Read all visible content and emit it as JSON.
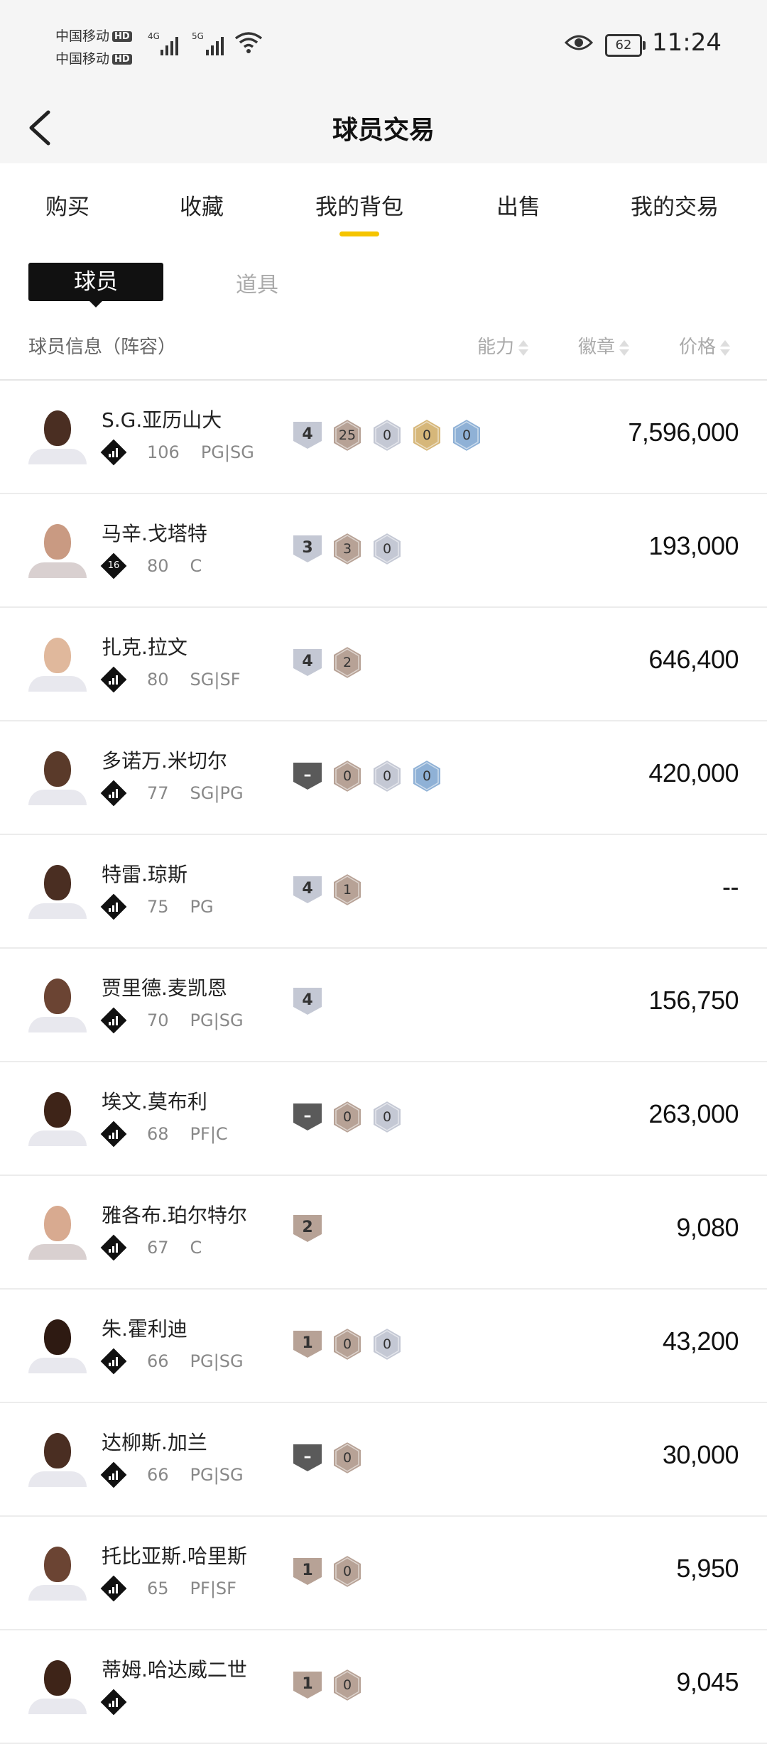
{
  "status_bar": {
    "carrier1": "中国移动",
    "carrier2": "中国移动",
    "hd": "HD",
    "sig1": "4G",
    "sig2": "5G",
    "battery": "62",
    "time": "11:24"
  },
  "header": {
    "title": "球员交易"
  },
  "tabs": [
    {
      "label": "购买"
    },
    {
      "label": "收藏"
    },
    {
      "label": "我的背包",
      "active": true
    },
    {
      "label": "出售"
    },
    {
      "label": "我的交易"
    }
  ],
  "subtabs": {
    "active": "球员",
    "inactive": "道具"
  },
  "columns": {
    "info": "球员信息（阵容）",
    "ability": "能力",
    "badge": "徽章",
    "price": "价格"
  },
  "colors": {
    "accent": "#f5c400",
    "silver": "#c4c8d4",
    "bronze": "#b7a296",
    "gold": "#d6b77a",
    "blue": "#8fb1d6",
    "dark_shield": "#5a5a5a"
  },
  "players": [
    {
      "name": "S.G.亚历山大",
      "rating": "106",
      "pos": "PG|SG",
      "tier_icon": "bars",
      "shield": {
        "label": "4",
        "color": "silver"
      },
      "badges": [
        {
          "label": "25",
          "color": "bronze"
        },
        {
          "label": "0",
          "color": "silver"
        },
        {
          "label": "0",
          "color": "gold"
        },
        {
          "label": "0",
          "color": "blue"
        }
      ],
      "price": "7,596,000",
      "skin": "#4a2e22",
      "shirt": "white"
    },
    {
      "name": "马辛.戈塔特",
      "rating": "80",
      "pos": "C",
      "tier_icon": "16",
      "shield": {
        "label": "3",
        "color": "silver"
      },
      "badges": [
        {
          "label": "3",
          "color": "bronze"
        },
        {
          "label": "0",
          "color": "silver"
        }
      ],
      "price": "193,000",
      "skin": "#c99a82",
      "shirt": "red"
    },
    {
      "name": "扎克.拉文",
      "rating": "80",
      "pos": "SG|SF",
      "tier_icon": "bars",
      "shield": {
        "label": "4",
        "color": "silver"
      },
      "badges": [
        {
          "label": "2",
          "color": "bronze"
        }
      ],
      "price": "646,400",
      "skin": "#e0b89c",
      "shirt": "white"
    },
    {
      "name": "多诺万.米切尔",
      "rating": "77",
      "pos": "SG|PG",
      "tier_icon": "bars",
      "shield": {
        "label": "–",
        "color": "dark"
      },
      "badges": [
        {
          "label": "0",
          "color": "bronze"
        },
        {
          "label": "0",
          "color": "silver"
        },
        {
          "label": "0",
          "color": "blue"
        }
      ],
      "price": "420,000",
      "skin": "#5a3a2a",
      "shirt": "white"
    },
    {
      "name": "特雷.琼斯",
      "rating": "75",
      "pos": "PG",
      "tier_icon": "bars",
      "shield": {
        "label": "4",
        "color": "silver"
      },
      "badges": [
        {
          "label": "1",
          "color": "bronze"
        }
      ],
      "price": "--",
      "skin": "#4a2e22",
      "shirt": "white"
    },
    {
      "name": "贾里德.麦凯恩",
      "rating": "70",
      "pos": "PG|SG",
      "tier_icon": "bars",
      "shield": {
        "label": "4",
        "color": "silver"
      },
      "badges": [],
      "price": "156,750",
      "skin": "#6b4433",
      "shirt": "white"
    },
    {
      "name": "埃文.莫布利",
      "rating": "68",
      "pos": "PF|C",
      "tier_icon": "bars",
      "shield": {
        "label": "–",
        "color": "dark"
      },
      "badges": [
        {
          "label": "0",
          "color": "bronze"
        },
        {
          "label": "0",
          "color": "silver"
        }
      ],
      "price": "263,000",
      "skin": "#3e2418",
      "shirt": "white"
    },
    {
      "name": "雅各布.珀尔特尔",
      "rating": "67",
      "pos": "C",
      "tier_icon": "bars",
      "shield": {
        "label": "2",
        "color": "bronze"
      },
      "badges": [],
      "price": "9,080",
      "skin": "#d8aa90",
      "shirt": "red"
    },
    {
      "name": "朱.霍利迪",
      "rating": "66",
      "pos": "PG|SG",
      "tier_icon": "bars",
      "shield": {
        "label": "1",
        "color": "bronze"
      },
      "badges": [
        {
          "label": "0",
          "color": "bronze"
        },
        {
          "label": "0",
          "color": "silver"
        }
      ],
      "price": "43,200",
      "skin": "#2e1a12",
      "shirt": "white"
    },
    {
      "name": "达柳斯.加兰",
      "rating": "66",
      "pos": "PG|SG",
      "tier_icon": "bars",
      "shield": {
        "label": "–",
        "color": "dark"
      },
      "badges": [
        {
          "label": "0",
          "color": "bronze"
        }
      ],
      "price": "30,000",
      "skin": "#4a2e22",
      "shirt": "white"
    },
    {
      "name": "托比亚斯.哈里斯",
      "rating": "65",
      "pos": "PF|SF",
      "tier_icon": "bars",
      "shield": {
        "label": "1",
        "color": "bronze"
      },
      "badges": [
        {
          "label": "0",
          "color": "bronze"
        }
      ],
      "price": "5,950",
      "skin": "#6b4433",
      "shirt": "white"
    },
    {
      "name": "蒂姆.哈达威二世",
      "rating": "",
      "pos": "",
      "tier_icon": "bars",
      "shield": {
        "label": "1",
        "color": "bronze"
      },
      "badges": [
        {
          "label": "0",
          "color": "bronze"
        }
      ],
      "price": "9,045",
      "skin": "#3e2418",
      "shirt": "white"
    }
  ]
}
